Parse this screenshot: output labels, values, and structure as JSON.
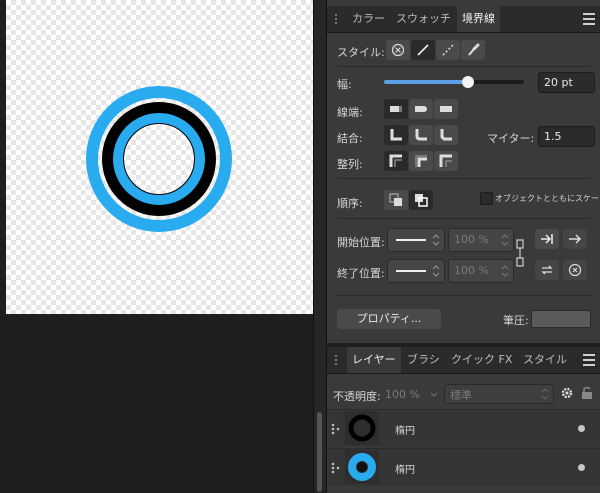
{
  "stroke_panel": {
    "tabs": [
      "カラー",
      "スウォッチ",
      "境界線"
    ],
    "style_label": "スタイル:",
    "width_label": "幅:",
    "width_value": "20 pt",
    "width_slider_fraction": 0.6,
    "cap_label": "線端:",
    "join_label": "結合:",
    "miter_label": "マイター:",
    "miter_value": "1.5",
    "align_label": "整列:",
    "order_label": "順序:",
    "scale_with_object_label": "オブジェクトとともにスケーリング",
    "start_label": "開始位置:",
    "start_percent": "100 %",
    "end_label": "終了位置:",
    "end_percent": "100 %",
    "properties_button": "プロパティ...",
    "pressure_label": "筆圧:"
  },
  "layers_panel": {
    "tabs": [
      "レイヤー",
      "ブラシ",
      "クイック FX",
      "スタイル"
    ],
    "opacity_label": "不透明度:",
    "opacity_value": "100 %",
    "blend_mode": "標準",
    "layers": [
      {
        "name": "楕円",
        "thumb": "black-ring"
      },
      {
        "name": "楕円",
        "thumb": "blue-ring"
      }
    ]
  },
  "colors": {
    "accent_blue": "#29abf0",
    "slider_blue": "#5ca0e8"
  }
}
